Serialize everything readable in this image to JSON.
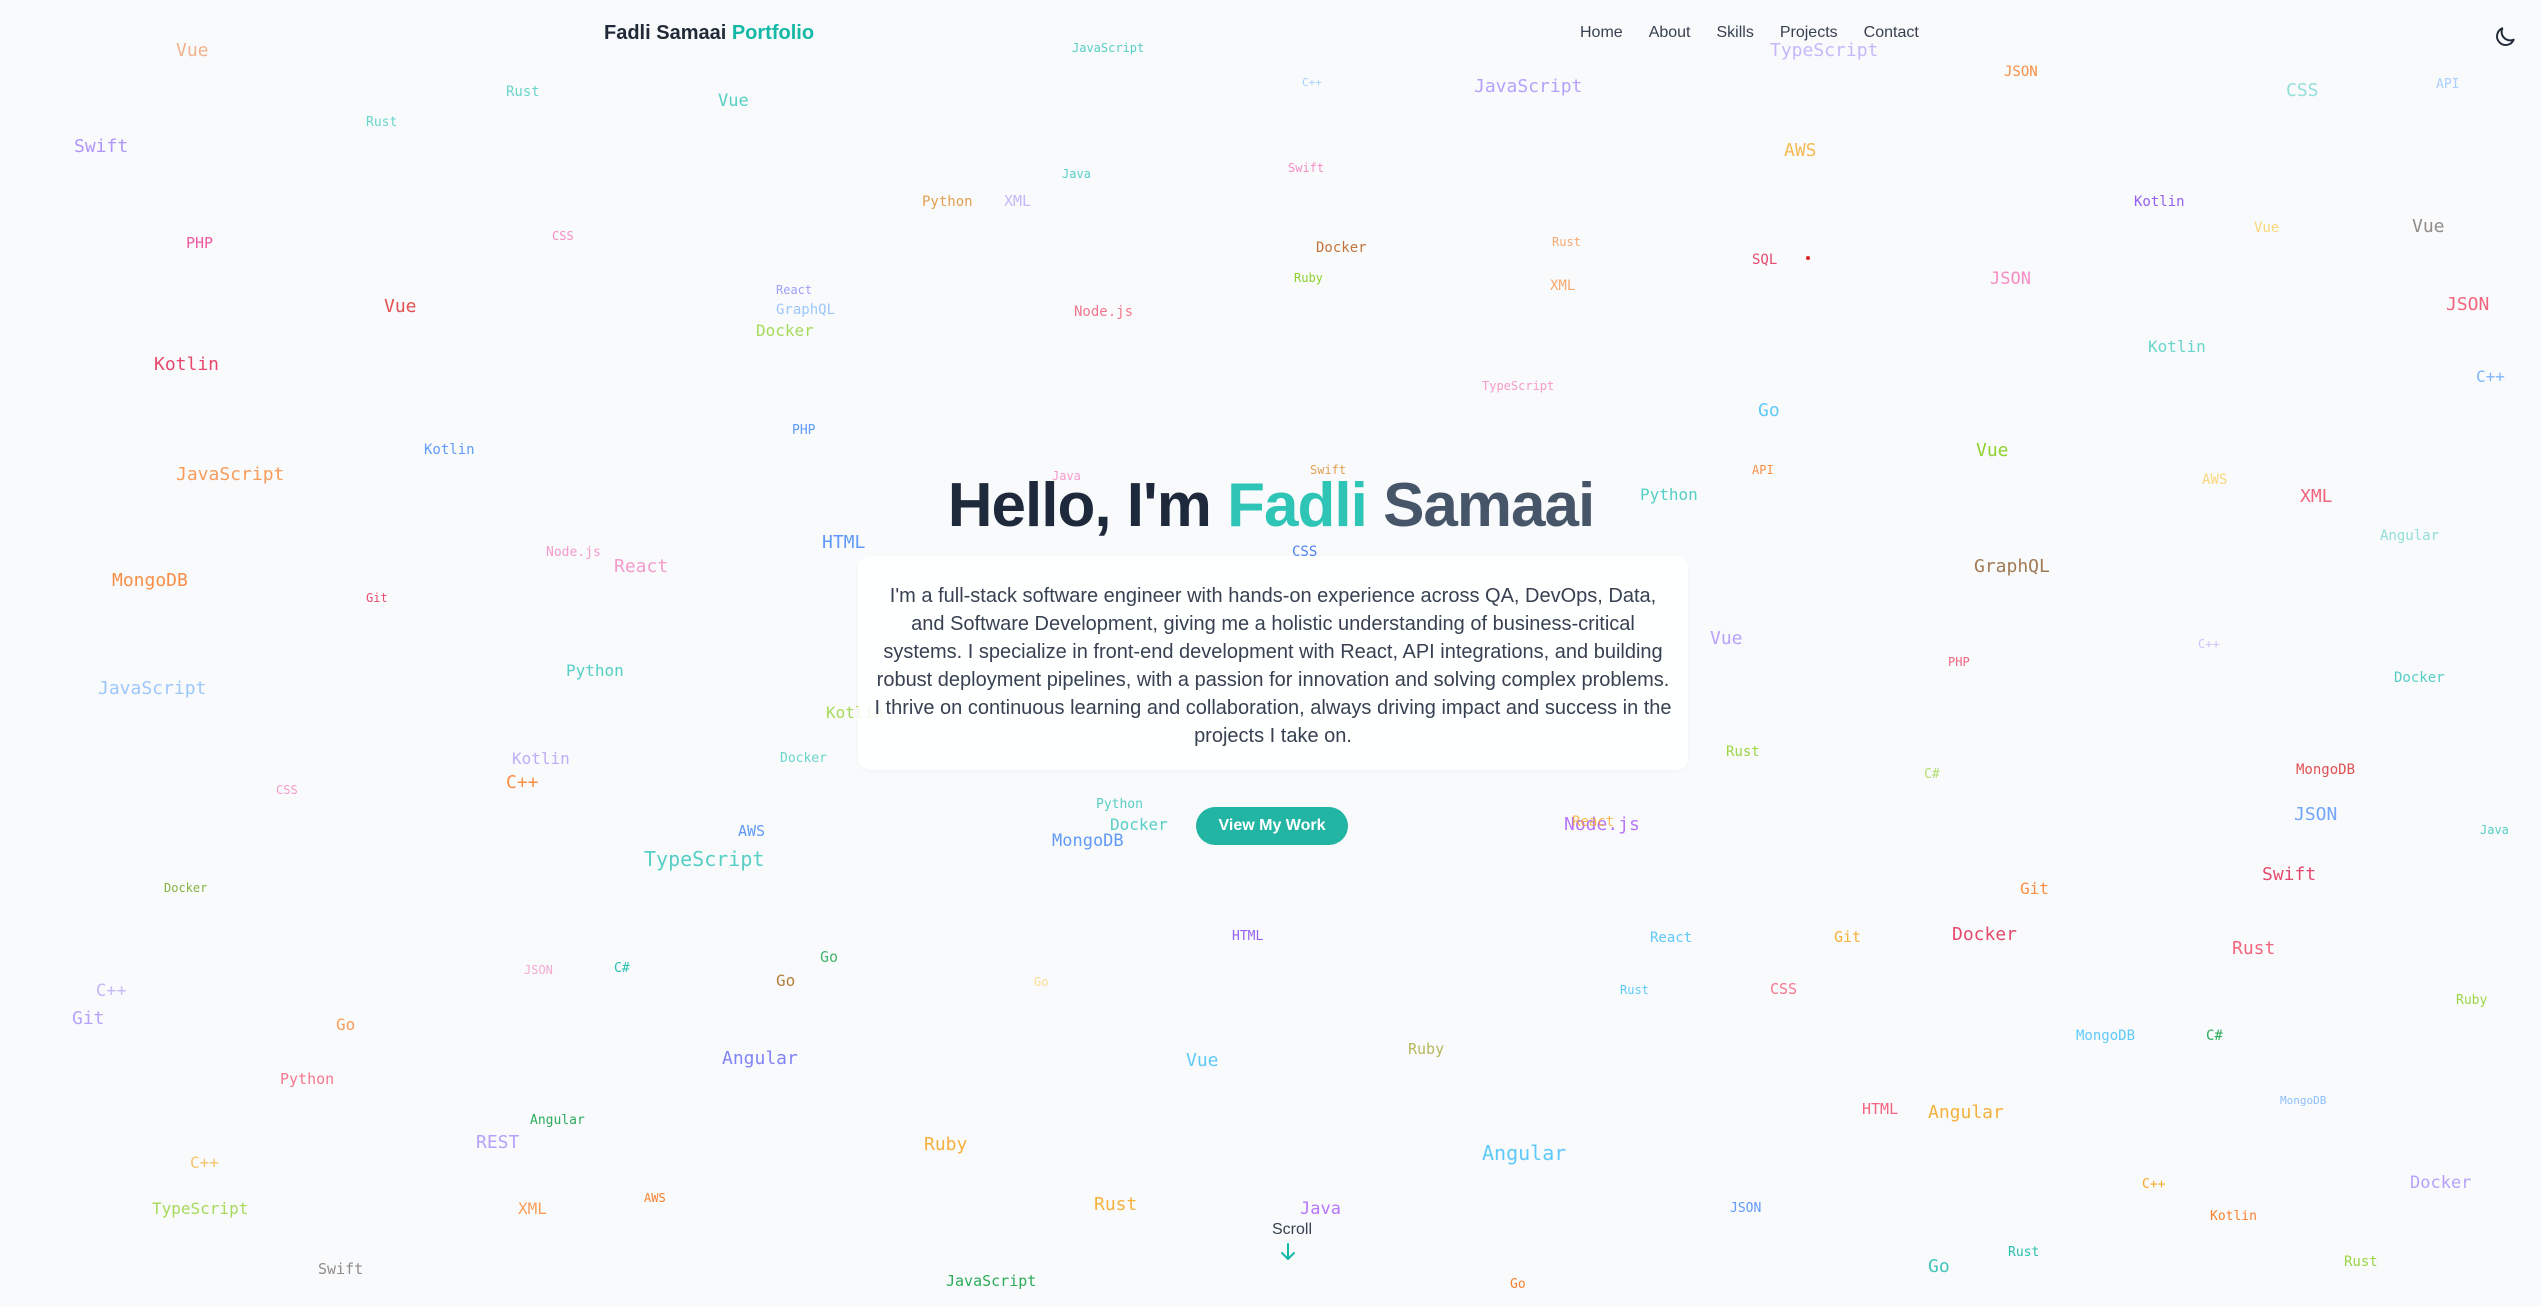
{
  "nav": {
    "brand_name": "Fadli Samaai",
    "brand_accent": "Portfolio",
    "links": [
      "Home",
      "About",
      "Skills",
      "Projects",
      "Contact"
    ],
    "theme_icon": "moon-icon"
  },
  "hero": {
    "greeting": "Hello, I'm",
    "first_name": "Fadli",
    "last_name": "Samaai",
    "bio": "I'm a full-stack software engineer with hands-on experience across QA, DevOps, Data, and Software Development, giving me a holistic understanding of business-critical systems. I specialize in front-end development with React, API integrations, and building robust deployment pipelines, with a passion for innovation and solving complex problems. I thrive on continuous learning and collaboration, always driving impact and success in the projects I take on.",
    "cta_label": "View My Work",
    "scroll_label": "Scroll",
    "scroll_icon": "arrow-down-icon"
  },
  "colors": {
    "accent": "#2ec4b6",
    "button": "#22b5a4",
    "background": "#f8fafc"
  },
  "background_words": [
    "Vue",
    "JavaScript",
    "C++",
    "JavaScript",
    "TypeScript",
    "JSON",
    "CSS",
    "API",
    "Rust",
    "Rust",
    "Vue",
    "Swift",
    "AWS",
    "XML",
    "Python",
    "Java",
    "Swift",
    "Kotlin",
    "Vue",
    "Vue",
    "PHP",
    "CSS",
    "Docker",
    "Rust",
    "SQL",
    "Vue",
    "Ruby",
    "JSON",
    "React",
    "GraphQL",
    "Node.js",
    "XML",
    "JSON",
    "Docker",
    "Kotlin",
    "Kotlin",
    "TypeScript",
    "C++",
    "Go",
    "PHP",
    "Kotlin",
    "Java",
    "Swift",
    "Vue",
    "JavaScript",
    "API",
    "AWS",
    "XML",
    "Python",
    "HTML",
    "CSS",
    "Node.js",
    "React",
    "GraphQL",
    "Angular",
    "MongoDB",
    "Git",
    "Vue",
    "C++",
    "JavaScript",
    "Python",
    "Docker",
    "PHP",
    "Kotlin",
    "Kotlin",
    "Docker",
    "Rust",
    "MongoDB",
    "C#",
    "C++",
    "CSS",
    "JSON",
    "Docker",
    "MongoDB",
    "Node.js",
    "React",
    "Java",
    "TypeScript",
    "AWS",
    "Python",
    "Docker",
    "Git",
    "Docker",
    "Git",
    "HTML",
    "React",
    "Swift",
    "JSON",
    "C++",
    "C#",
    "Go",
    "Go",
    "Go",
    "Rust",
    "Rust",
    "Git",
    "CSS",
    "Go",
    "Ruby",
    "MongoDB",
    "Python",
    "C#",
    "Angular",
    "Vue",
    "Ruby",
    "HTML",
    "Angular",
    "Angular",
    "MongoDB",
    "Angular",
    "Ruby",
    "REST",
    "C++",
    "AWS",
    "TypeScript",
    "XML",
    "Rust",
    "Java",
    "JSON",
    "C++",
    "Docker",
    "Kotlin",
    "Swift",
    "Rust",
    "Go",
    "Rust",
    "Go",
    "JavaScript"
  ]
}
